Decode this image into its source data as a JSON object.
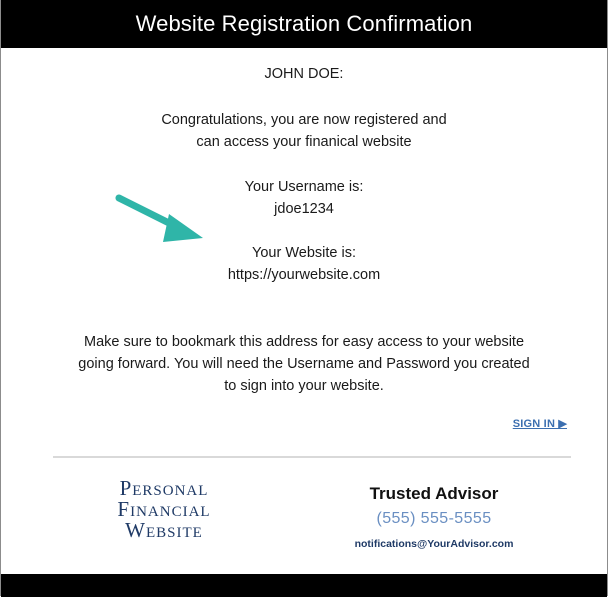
{
  "header": {
    "title": "Website Registration Confirmation"
  },
  "message": {
    "recipient": "JOHN DOE:",
    "congrats_line1": "Congratulations, you are now registered and",
    "congrats_line2": "can access your finanical website",
    "username_label": "Your Username is:",
    "username_value": "jdoe1234",
    "website_label": "Your Website is:",
    "website_value": "https://yourwebsite.com",
    "bookmark_line1": "Make sure to bookmark this address for easy access to your website",
    "bookmark_line2": "going forward. You will need the Username and Password you created",
    "bookmark_line3": "to sign into your website.",
    "sign_in_label": "SIGN IN ▶",
    "arrow_icon": "arrow-right-down-icon",
    "arrow_color": "#2fb5a8"
  },
  "footer": {
    "logo": {
      "line1": "Personal",
      "line2": "Financial",
      "line3": "Website"
    },
    "advisor_name": "Trusted Advisor",
    "advisor_phone": "(555) 555-5555",
    "advisor_email": "notifications@YourAdvisor.com"
  },
  "colors": {
    "header_bg": "#000000",
    "link": "#3c6fb0",
    "logo": "#1f3a66",
    "phone": "#6a8fc2"
  }
}
